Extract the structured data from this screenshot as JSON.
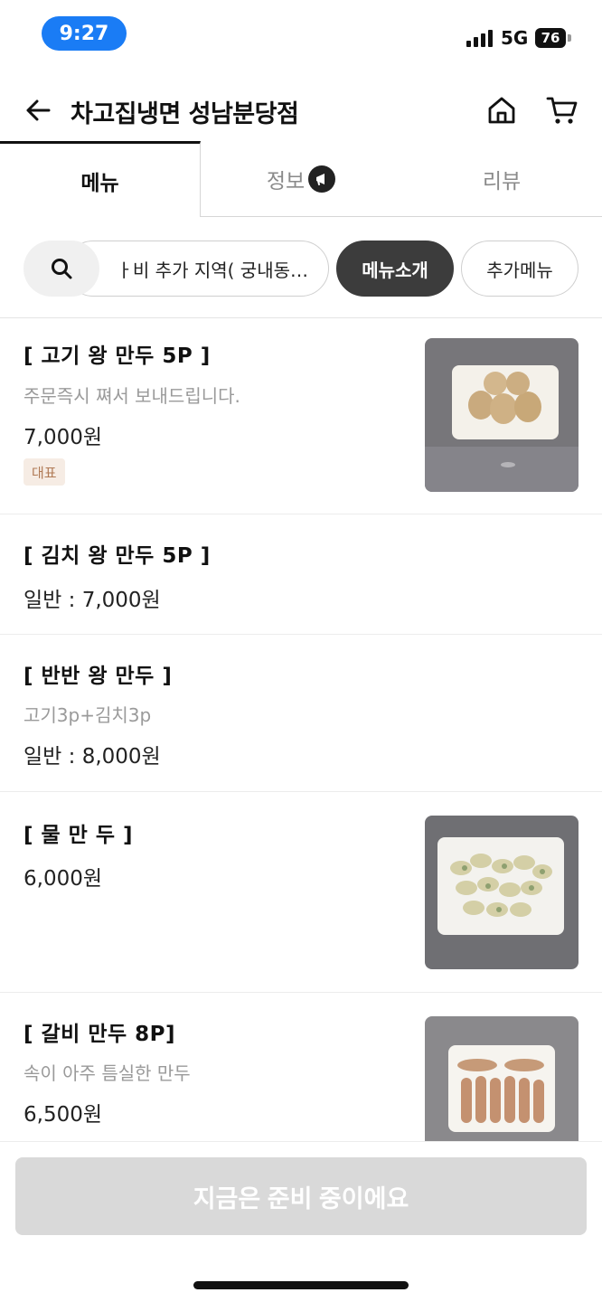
{
  "status": {
    "time": "9:27",
    "network": "5G",
    "battery": "76"
  },
  "header": {
    "title": "차고집냉면 성남분당점"
  },
  "tabs": [
    {
      "label": "메뉴"
    },
    {
      "label": "정보"
    },
    {
      "label": "리뷰"
    }
  ],
  "categories": {
    "partial_label": "ㅏ비 추가 지역( 궁내동…",
    "active_label": "메뉴소개",
    "extra_label": "추가메뉴"
  },
  "menu": [
    {
      "name": "[ 고기 왕 만두 5P ]",
      "description": "주문즉시 쪄서 보내드립니다.",
      "price": "7,000원",
      "badge": "대표"
    },
    {
      "name": "[ 김치 왕 만두 5P ]",
      "price": "일반 : 7,000원"
    },
    {
      "name": "[ 반반 왕 만두 ]",
      "description": "고기3p+김치3p",
      "price": "일반 : 8,000원"
    },
    {
      "name": "[  물 만 두  ]",
      "price": "6,000원"
    },
    {
      "name": "[ 갈비 만두 8P]",
      "description": "속이 아주 틈실한 만두",
      "price": "6,500원"
    }
  ],
  "bottom": {
    "button_label": "지금은 준비 중이에요"
  },
  "colors": {
    "accent": "#1a7cf5",
    "chip_active": "#3c3c3c",
    "disabled_button": "#d9d9d9",
    "badge_bg": "#f6ece4",
    "badge_text": "#b07a55"
  },
  "icons": [
    "back-arrow-icon",
    "home-icon",
    "cart-icon",
    "megaphone-icon",
    "search-icon"
  ]
}
